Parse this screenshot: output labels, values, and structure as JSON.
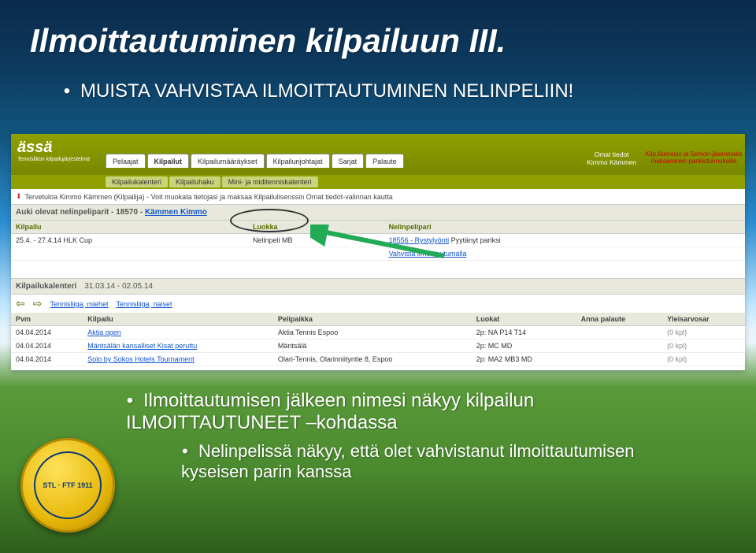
{
  "slide": {
    "title": "Ilmoittautuminen kilpailuun III.",
    "bullet1": "MUISTA VAHVISTAA ILMOITTAUTUMINEN NELINPELIIN!",
    "bullet2": "Ilmoittautumisen jälkeen nimesi näkyy kilpailun ILMOITTAUTUNEET –kohdassa",
    "bullet3": "Nelinpelissä näkyy, että olet vahvistanut ilmoittautumisen kyseisen parin kanssa",
    "badge_text": "STL · FTF\n1911"
  },
  "app": {
    "logo_line1": "ässä",
    "logo_line2": "Tennisliiton kilpailujärjestelmä",
    "nav1": {
      "items": [
        "Pelaajat",
        "Kilpailut",
        "Kilpailumääräykset",
        "Kilpailunjohtajat",
        "Sarjat",
        "Palaute"
      ],
      "omat_line1": "Omat tiedot",
      "omat_line2": "Kimmo Kämmen",
      "kilp_line1": "Kilp.lisenssin ja Seniori-jäsenmaks",
      "kilp_line2": "maksaminen pankkitunnuksilla"
    },
    "nav2": {
      "items": [
        "Kilpailukalenteri",
        "Kilpailuhaku",
        "Mini- ja miditenniskalenteri"
      ]
    },
    "welcome": "Tervetuloa Kimmo Kämmen (Kilpailija) - Voit muokata tietojasi ja maksaa Kilpailulisenssin Omat tiedot-valinnan kautta",
    "pairs": {
      "title_prefix": "Auki olevat nelinpeliparit - 18570 - ",
      "title_link": "Kämmen Kimmo",
      "cols": [
        "Kilpailu",
        "Luokka",
        "Nelinpelipari"
      ],
      "row": {
        "kilpailu": "25.4. - 27.4.14 HLK Cup",
        "luokka": "Nelinpeli  MB",
        "pari_text": "18556 - Rystylyönti",
        "status": "Pyytänyt pariksi",
        "confirm_link": "Vahvista ilmoittautumalla"
      }
    },
    "calendar": {
      "title": "Kilpailukalenteri",
      "daterange": "31.03.14 - 02.05.14",
      "tabs": [
        "Tennisliiga, miehet",
        "Tennisliiga, naiset"
      ],
      "cols": [
        "Pvm",
        "Kilpailu",
        "Pelipaikka",
        "Luokat",
        "Anna palaute",
        "Yleisarvosar"
      ],
      "rows": [
        {
          "pvm": "04.04.2014",
          "kilpailu": "Aktia open",
          "paikka": "Aktia Tennis Espoo",
          "luokat": "2p: NA  P14  T14",
          "pal": "(0 kpl)"
        },
        {
          "pvm": "04.04.2014",
          "kilpailu": "Mäntsälän kansalliset Kisat peruttu",
          "paikka": "Mäntsälä",
          "luokat": "2p: MC  MD",
          "pal": "(0 kpl)"
        },
        {
          "pvm": "04.04.2014",
          "kilpailu": "Solo by Sokos Hotels Tournament",
          "paikka": "Olari-Tennis, Olarinniityntie 8, Espoo",
          "luokat": "2p: MA2  MB3  MD",
          "pal": "(0 kpl)"
        }
      ]
    }
  }
}
